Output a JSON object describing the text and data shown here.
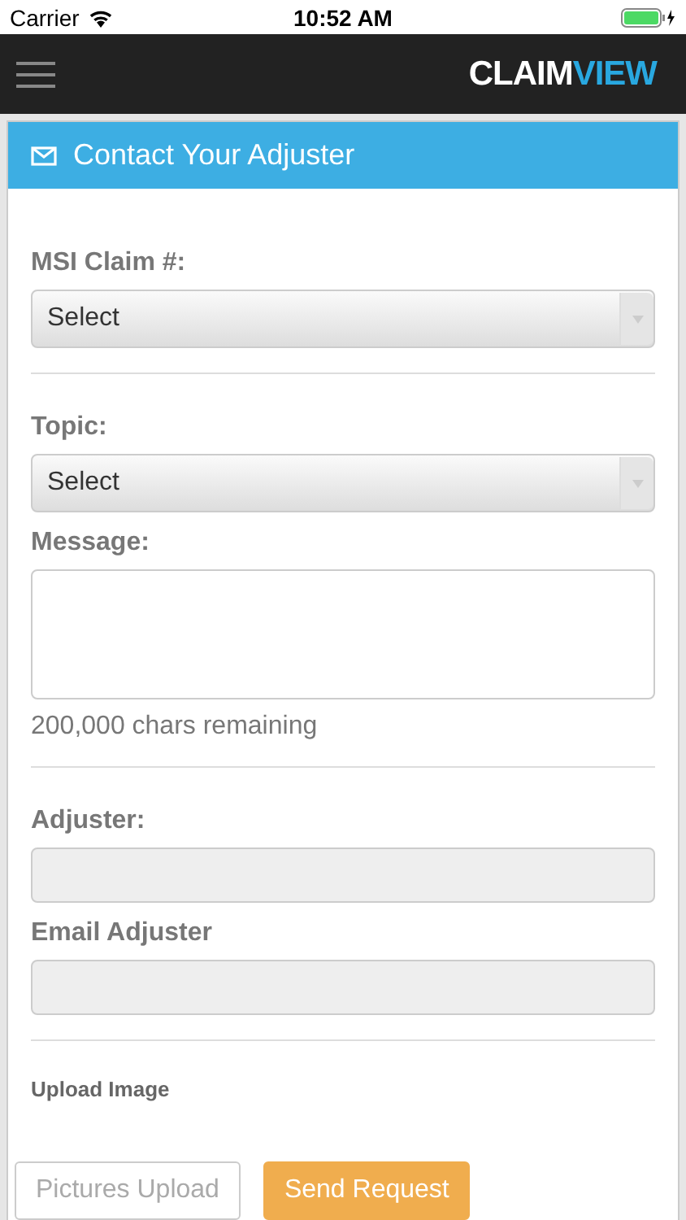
{
  "status_bar": {
    "carrier": "Carrier",
    "time": "10:52 AM"
  },
  "nav": {
    "logo_part_1": "CLAIM",
    "logo_part_2": "VIEW"
  },
  "card": {
    "title": "Contact Your Adjuster"
  },
  "fields": [
    {
      "kind": "select",
      "label": "MSI Claim #:",
      "value": "Select"
    },
    {
      "kind": "divider"
    },
    {
      "kind": "select",
      "label": "Topic:",
      "value": "Select"
    },
    {
      "kind": "textarea",
      "label": "Message:",
      "note": "200,000 chars remaining"
    },
    {
      "kind": "divider"
    },
    {
      "kind": "input",
      "label": "Adjuster:",
      "disabled": true
    },
    {
      "kind": "input",
      "label": "Email Adjuster",
      "disabled": true
    },
    {
      "kind": "divider"
    }
  ],
  "upload": {
    "label": "Upload Image"
  },
  "buttons": [
    {
      "kind": "outline",
      "label": "Pictures Upload"
    },
    {
      "kind": "primary",
      "label": "Send Request"
    }
  ]
}
